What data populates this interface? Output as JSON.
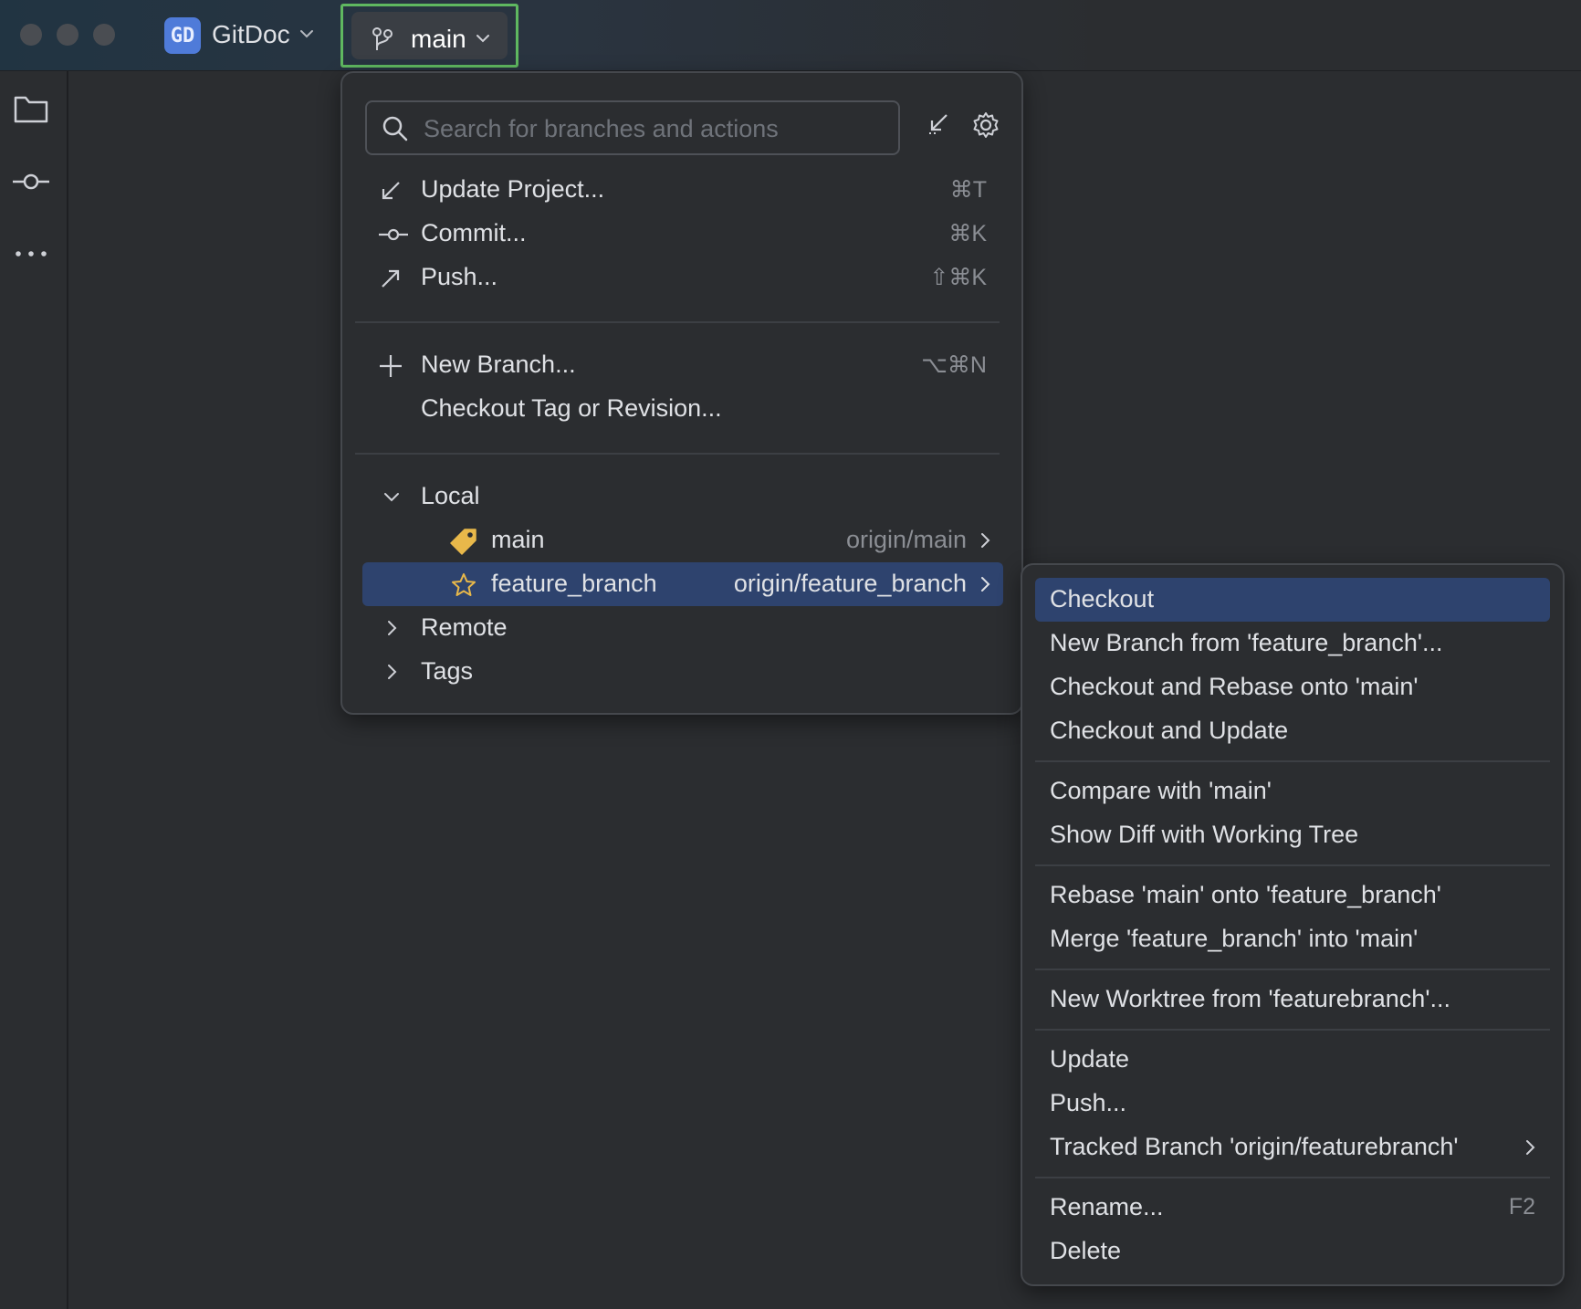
{
  "titlebar": {
    "project_badge": "GD",
    "project_name": "GitDoc",
    "current_branch": "main"
  },
  "sidebar": {
    "items": [
      {
        "icon": "folder-icon"
      },
      {
        "icon": "commit-icon"
      },
      {
        "icon": "more-icon"
      }
    ]
  },
  "branch_popup": {
    "search_placeholder": "Search for branches and actions",
    "actions": [
      {
        "label": "Update Project...",
        "shortcut": "⌘T",
        "icon": "update-icon"
      },
      {
        "label": "Commit...",
        "shortcut": "⌘K",
        "icon": "commit-icon"
      },
      {
        "label": "Push...",
        "shortcut": "⇧⌘K",
        "icon": "push-icon"
      }
    ],
    "branch_actions": [
      {
        "label": "New Branch...",
        "shortcut": "⌥⌘N",
        "icon": "plus-icon"
      },
      {
        "label": "Checkout Tag or Revision...",
        "shortcut": ""
      }
    ],
    "tree": {
      "local_label": "Local",
      "local_branches": [
        {
          "name": "main",
          "remote": "origin/main",
          "icon": "tag-icon"
        },
        {
          "name": "feature_branch",
          "remote": "origin/feature_branch",
          "icon": "star-icon",
          "selected": true
        }
      ],
      "remote_label": "Remote",
      "tags_label": "Tags"
    }
  },
  "branch_submenu": {
    "groups": [
      [
        {
          "label": "Checkout",
          "selected": true
        },
        {
          "label": "New Branch from 'feature_branch'..."
        },
        {
          "label": "Checkout and Rebase onto 'main'"
        },
        {
          "label": "Checkout and Update"
        }
      ],
      [
        {
          "label": "Compare with 'main'"
        },
        {
          "label": "Show Diff with Working Tree"
        }
      ],
      [
        {
          "label": "Rebase 'main' onto 'feature_branch'"
        },
        {
          "label": "Merge 'feature_branch' into 'main'"
        }
      ],
      [
        {
          "label": "New Worktree from 'featurebranch'..."
        }
      ],
      [
        {
          "label": "Update"
        },
        {
          "label": "Push..."
        },
        {
          "label": "Tracked Branch 'origin/featurebranch'",
          "has_submenu": true
        }
      ],
      [
        {
          "label": "Rename...",
          "shortcut": "F2"
        },
        {
          "label": "Delete"
        }
      ]
    ]
  },
  "colors": {
    "background": "#2b2d30",
    "selection": "#2e436e",
    "focus_border": "#5fb860",
    "project_badge": "#4f7bd9",
    "tag_icon": "#e8b84a",
    "star_icon": "#e8b84a"
  }
}
